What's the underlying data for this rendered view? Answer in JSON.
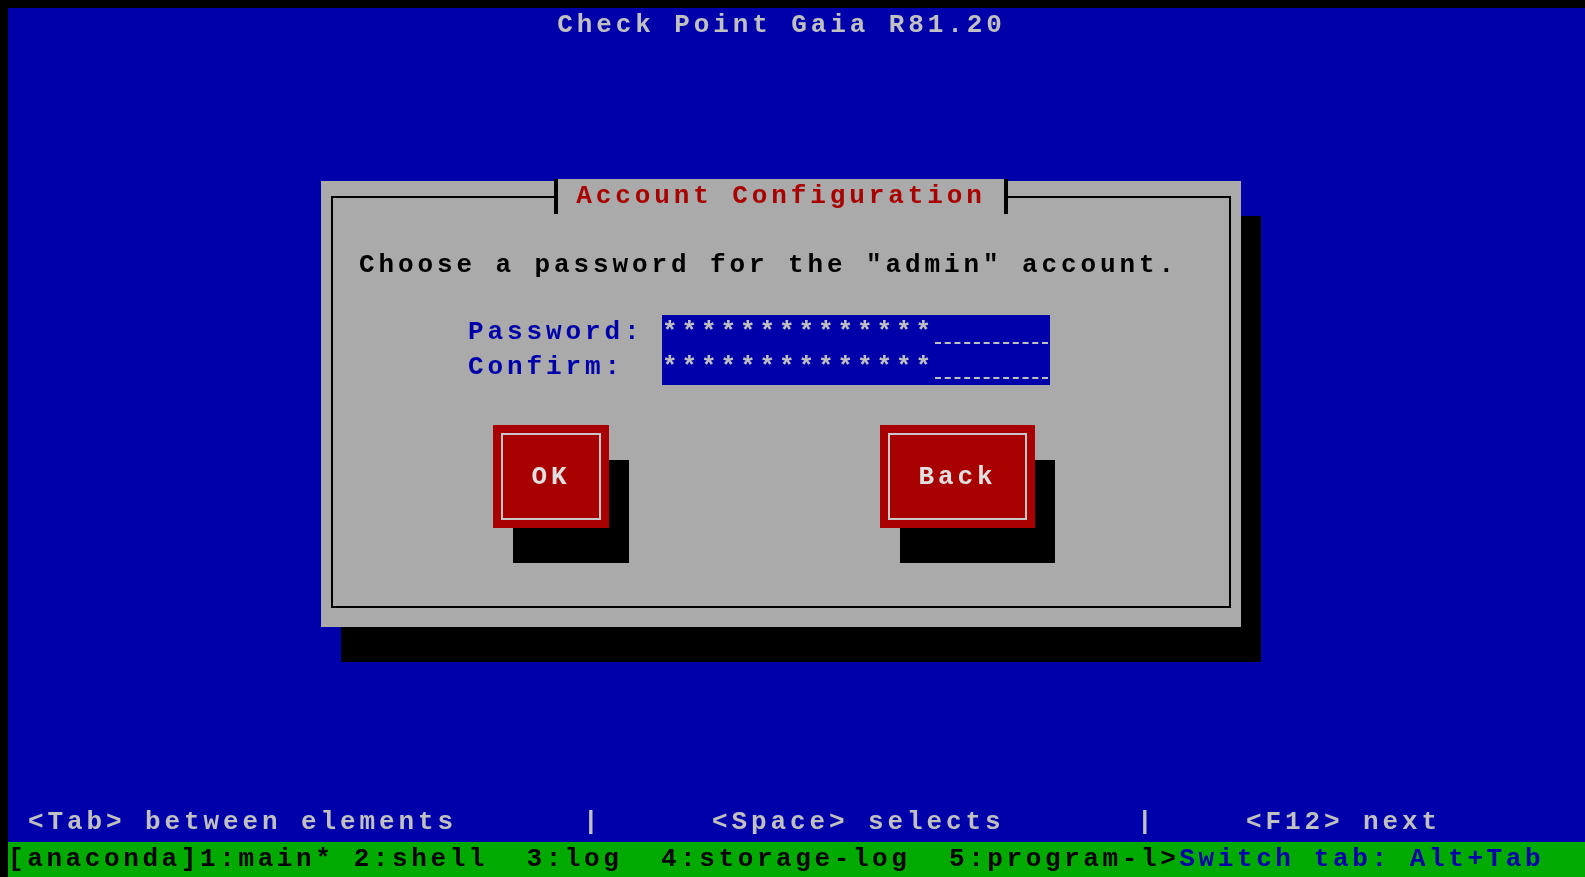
{
  "screen_title": "Check Point Gaia R81.20",
  "dialog": {
    "title": "Account Configuration",
    "message": "Choose a password for the \"admin\" account.",
    "fields": [
      {
        "label": "Password:",
        "value": "**************"
      },
      {
        "label": "Confirm:",
        "value": "**************"
      }
    ],
    "buttons": [
      "OK",
      "Back"
    ]
  },
  "hints": {
    "items": [
      "<Tab> between elements",
      "<Space> selects",
      "<F12> next"
    ],
    "separator": "|"
  },
  "status_bar": {
    "sessions": "[anaconda]1:main* 2:shell  3:log  4:storage-log  5:program-l>",
    "switch_hint": "Switch tab: Alt+Tab"
  }
}
